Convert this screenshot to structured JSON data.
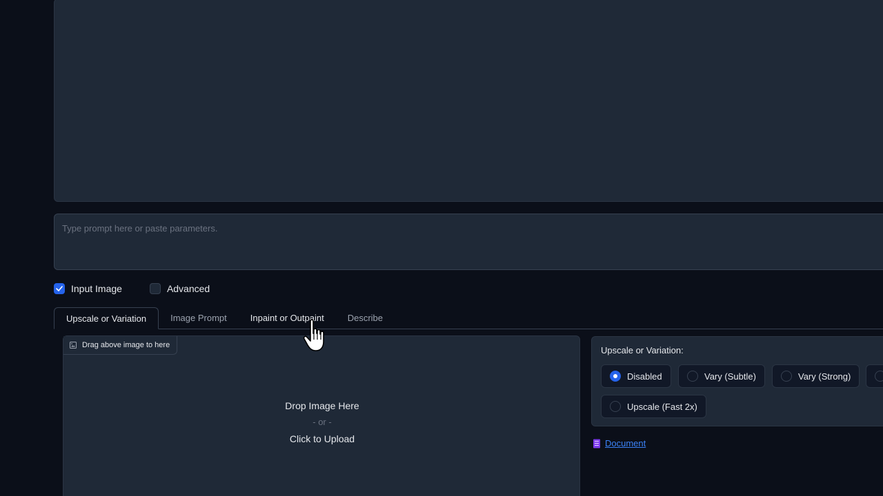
{
  "prompt": {
    "placeholder": "Type prompt here or paste parameters."
  },
  "options": {
    "input_image": {
      "label": "Input Image",
      "checked": true
    },
    "advanced": {
      "label": "Advanced",
      "checked": false
    }
  },
  "tabs": [
    {
      "label": "Upscale or Variation",
      "active": true
    },
    {
      "label": "Image Prompt",
      "active": false
    },
    {
      "label": "Inpaint or Outpaint",
      "active": false
    },
    {
      "label": "Describe",
      "active": false
    }
  ],
  "upload": {
    "drag_label": "Drag above image to here",
    "drop_text": "Drop Image Here",
    "or_text": "- or -",
    "click_text": "Click to Upload"
  },
  "upscale_variation": {
    "title": "Upscale or Variation:",
    "options": [
      {
        "label": "Disabled",
        "selected": true
      },
      {
        "label": "Vary (Subtle)",
        "selected": false
      },
      {
        "label": "Vary (Strong)",
        "selected": false
      },
      {
        "label": "Upscale (Fast 2x)",
        "selected": false
      }
    ]
  },
  "document_link": {
    "label": "Document",
    "icon": "document-icon"
  },
  "colors": {
    "background": "#0b0f19",
    "panel": "#1f2937",
    "accent": "#2563eb",
    "link": "#3b82f6"
  }
}
